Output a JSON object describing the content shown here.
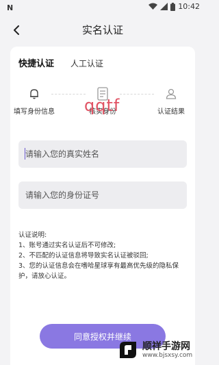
{
  "status_bar": {
    "notification": "N",
    "time": "10:42"
  },
  "header": {
    "title": "实名认证"
  },
  "tabs": [
    {
      "label": "快捷认证",
      "active": true
    },
    {
      "label": "人工认证",
      "active": false
    }
  ],
  "steps": [
    {
      "label": "填写身份信息",
      "icon": "bell-icon"
    },
    {
      "label": "核实身份",
      "icon": "document-icon"
    },
    {
      "label": "认证结果",
      "icon": "person-icon"
    }
  ],
  "watermark_text": "qqtf",
  "form": {
    "name_placeholder": "请输入您的真实姓名",
    "id_placeholder": "请输入您的身份证号"
  },
  "notes": {
    "title": "认证说明:",
    "items": [
      "1、账号通过实名认证后不可修改;",
      "2、不匹配的认证信息将导致实名认证被驳回;",
      "3、您的认证信息会在嗜哈星球享有最高优先级的隐私保护，请放心认证。"
    ]
  },
  "agree_button": "同意授权并继续",
  "brand": {
    "name": "顺祥手游网",
    "url": "www.bjsxsy.com"
  },
  "colors": {
    "accent": "#8a78e2",
    "watermark": "#e05263"
  }
}
